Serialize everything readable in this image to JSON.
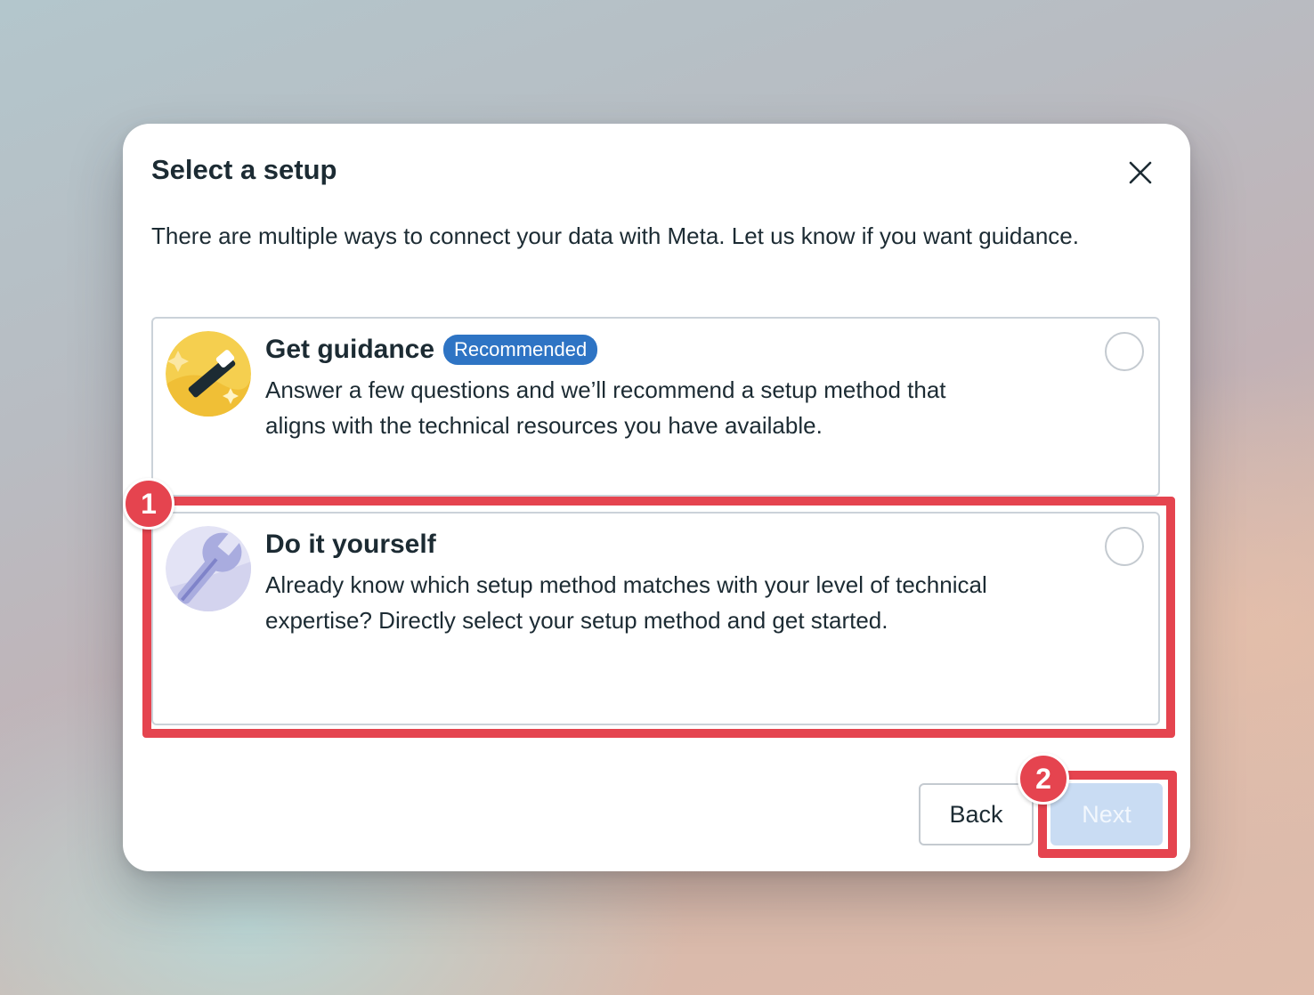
{
  "dialog": {
    "title": "Select a setup",
    "intro": "There are multiple ways to connect your data with Meta. Let us know if you want guidance."
  },
  "options": [
    {
      "title": "Get guidance",
      "badge": "Recommended",
      "description": "Answer a few questions and we’ll recommend a setup method that aligns with the technical resources you have available.",
      "icon": "magic-wand-icon",
      "selected": false
    },
    {
      "title": "Do it yourself",
      "description": "Already know which setup method matches with your level of technical expertise? Directly select your setup method and get started.",
      "icon": "wrench-icon",
      "selected": false
    }
  ],
  "buttons": {
    "back": "Back",
    "next": "Next"
  },
  "annotations": {
    "step1": "1",
    "step2": "2",
    "color": "#e5444f"
  },
  "colors": {
    "badge": "#2e74c4",
    "next_disabled": "#c9dcf3"
  }
}
